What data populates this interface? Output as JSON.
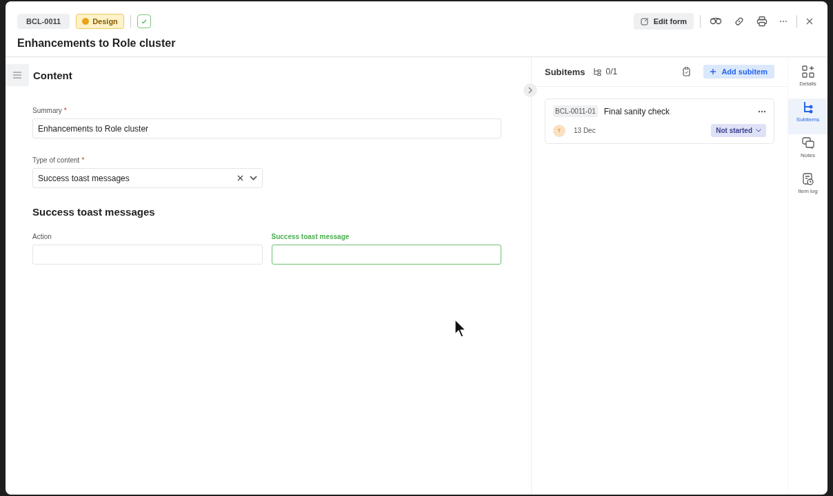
{
  "header": {
    "item_id": "BCL-0011",
    "tag": {
      "label": "Design",
      "color": "#e8a317"
    },
    "done_checked": true,
    "title": "Enhancements to Role cluster"
  },
  "toolbar": {
    "edit_label": "Edit form"
  },
  "content": {
    "heading": "Content",
    "fields": [
      {
        "label": "Summary",
        "required_mark": "*",
        "value": "Enhancements to Role cluster",
        "kind": "text",
        "focused": false
      },
      {
        "label": "Type of content",
        "required_mark": "*",
        "value": "Success toast messages",
        "kind": "select",
        "focused": false
      }
    ],
    "section": {
      "heading": "Success toast messages",
      "fields": [
        {
          "label": "Action",
          "focused": false
        },
        {
          "label": "Success toast message",
          "focused": true
        }
      ]
    }
  },
  "subitems": {
    "title": "Subitems",
    "count": "0/1",
    "add_label": "Add subitem",
    "items": [
      {
        "id": "BCL-0011-01",
        "title": "Final sanity check",
        "avatar": "T",
        "date": "13 Dec",
        "status": "Not started"
      }
    ]
  },
  "rail": [
    {
      "label": "Details",
      "selected": false
    },
    {
      "label": "Subitems",
      "selected": true
    },
    {
      "label": "Notes",
      "selected": false
    },
    {
      "label": "Item log",
      "selected": false
    }
  ]
}
